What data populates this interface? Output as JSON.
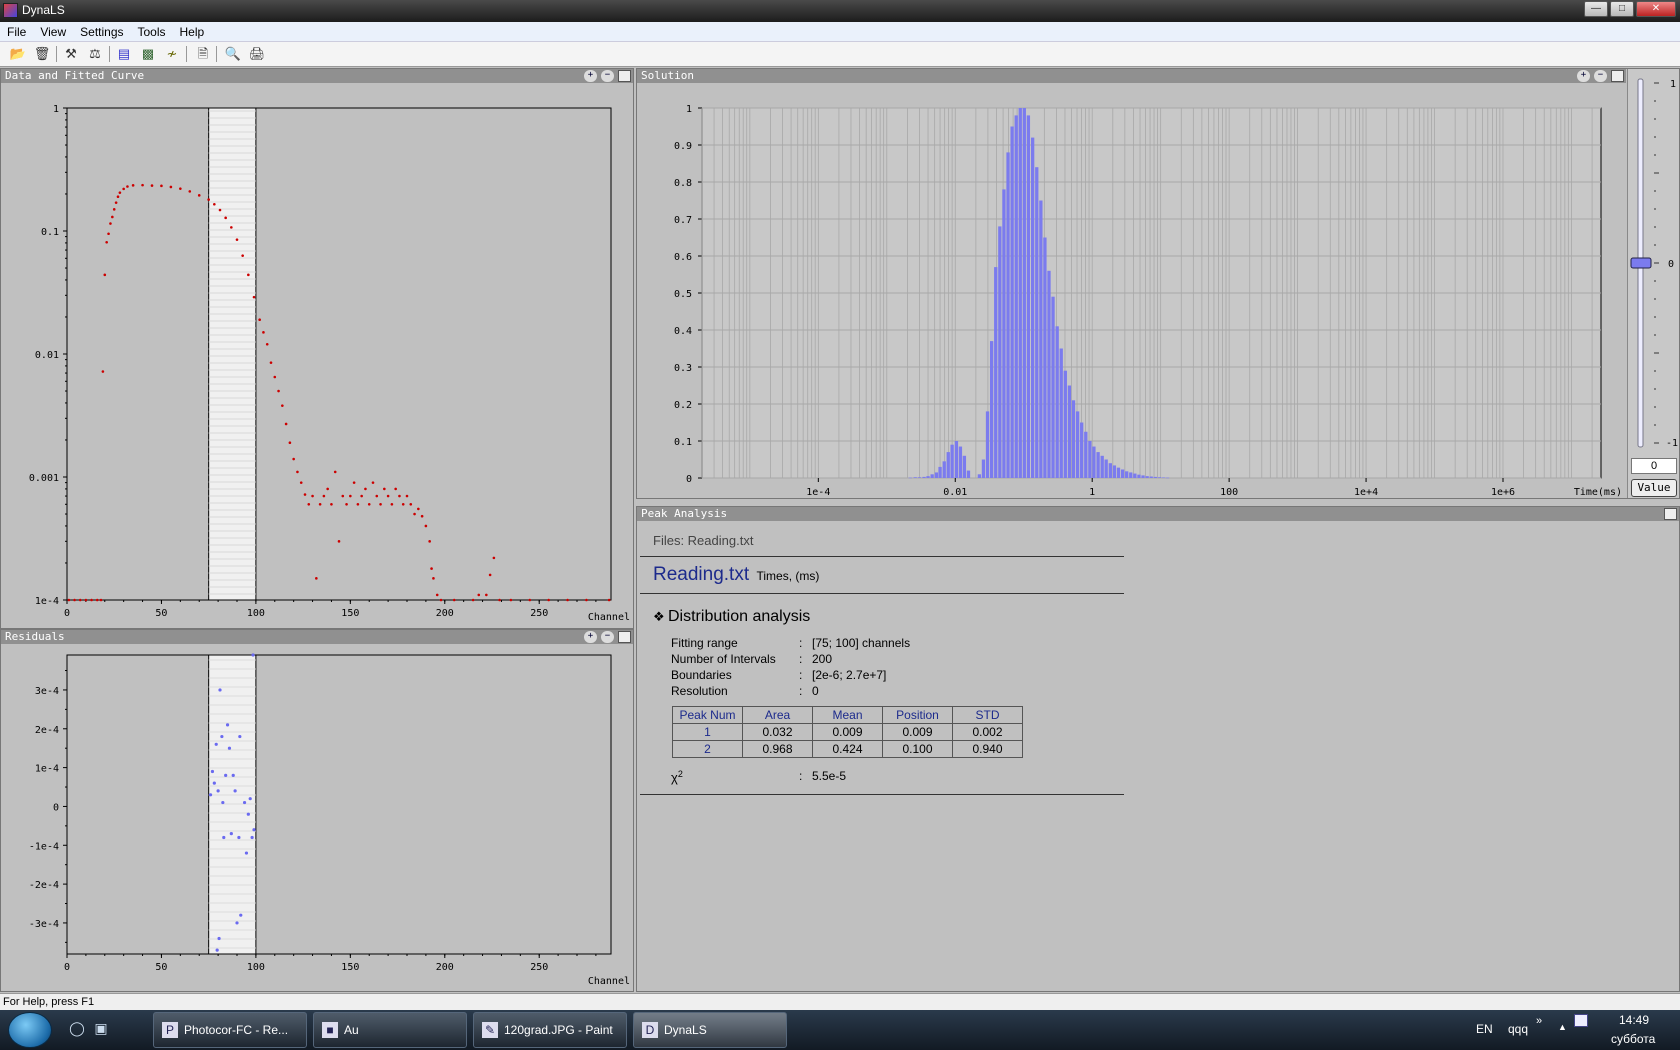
{
  "window": {
    "title": "DynaLS"
  },
  "menu": [
    "File",
    "View",
    "Settings",
    "Tools",
    "Help"
  ],
  "toolbar_icons": [
    "open-icon",
    "delete-icon",
    "tools-icon",
    "balance-icon",
    "histogram-icon",
    "bar-chart-icon",
    "fit-icon",
    "report-icon",
    "print-preview-icon",
    "print-icon"
  ],
  "panels": {
    "data": "Data and Fitted Curve",
    "residuals": "Residuals",
    "solution": "Solution",
    "peak": "Peak Analysis"
  },
  "chart_data": [
    {
      "type": "scatter",
      "title": "Data and Fitted Curve",
      "xlabel": "Channel",
      "xlim": [
        0,
        288
      ],
      "ylim": [
        0.0001,
        1
      ],
      "yscale": "log",
      "xticks": [
        0,
        50,
        100,
        150,
        200,
        250
      ],
      "yticks": [
        "1",
        "0.1",
        "0.01",
        "0.001",
        "1e-4"
      ],
      "fit_range": [
        75,
        100
      ],
      "series": [
        {
          "color": "#cc0000",
          "points": [
            [
              1,
              0.0001
            ],
            [
              4,
              0.0001
            ],
            [
              7,
              0.0001
            ],
            [
              10,
              0.0001
            ],
            [
              13,
              0.0001
            ],
            [
              16,
              0.0001
            ],
            [
              18,
              0.0001
            ],
            [
              19,
              0.0072
            ],
            [
              20,
              0.044
            ],
            [
              21,
              0.081
            ],
            [
              22,
              0.095
            ],
            [
              23,
              0.115
            ],
            [
              24,
              0.13
            ],
            [
              25,
              0.15
            ],
            [
              26,
              0.17
            ],
            [
              27,
              0.19
            ],
            [
              28,
              0.205
            ],
            [
              30,
              0.22
            ],
            [
              32,
              0.23
            ],
            [
              35,
              0.235
            ],
            [
              40,
              0.236
            ],
            [
              45,
              0.234
            ],
            [
              50,
              0.233
            ],
            [
              55,
              0.228
            ],
            [
              60,
              0.221
            ],
            [
              65,
              0.21
            ],
            [
              70,
              0.195
            ],
            [
              75,
              0.18
            ],
            [
              78,
              0.165
            ],
            [
              81,
              0.148
            ],
            [
              84,
              0.128
            ],
            [
              87,
              0.107
            ],
            [
              90,
              0.085
            ],
            [
              93,
              0.063
            ],
            [
              96,
              0.044
            ],
            [
              99,
              0.029
            ],
            [
              102,
              0.019
            ],
            [
              104,
              0.015
            ],
            [
              106,
              0.012
            ],
            [
              108,
              0.0085
            ],
            [
              110,
              0.0065
            ],
            [
              112,
              0.005
            ],
            [
              114,
              0.0038
            ],
            [
              116,
              0.0027
            ],
            [
              118,
              0.0019
            ],
            [
              120,
              0.0014
            ],
            [
              122,
              0.0011
            ],
            [
              124,
              0.0009
            ],
            [
              126,
              0.00072
            ],
            [
              128,
              0.0006
            ],
            [
              130,
              0.0007
            ],
            [
              132,
              0.00015
            ],
            [
              134,
              0.0006
            ],
            [
              136,
              0.0007
            ],
            [
              138,
              0.0008
            ],
            [
              140,
              0.0006
            ],
            [
              142,
              0.0011
            ],
            [
              144,
              0.0003
            ],
            [
              146,
              0.0007
            ],
            [
              148,
              0.0006
            ],
            [
              150,
              0.0007
            ],
            [
              152,
              0.0009
            ],
            [
              154,
              0.0006
            ],
            [
              156,
              0.0007
            ],
            [
              158,
              0.0008
            ],
            [
              160,
              0.0006
            ],
            [
              162,
              0.0009
            ],
            [
              164,
              0.0007
            ],
            [
              166,
              0.0006
            ],
            [
              168,
              0.0008
            ],
            [
              170,
              0.0007
            ],
            [
              172,
              0.0006
            ],
            [
              174,
              0.0008
            ],
            [
              176,
              0.0007
            ],
            [
              178,
              0.0006
            ],
            [
              180,
              0.0007
            ],
            [
              182,
              0.0006
            ],
            [
              184,
              0.0005
            ],
            [
              186,
              0.00055
            ],
            [
              188,
              0.00048
            ],
            [
              190,
              0.0004
            ],
            [
              192,
              0.0003
            ],
            [
              193,
              0.00018
            ],
            [
              194,
              0.00015
            ],
            [
              196,
              0.00011
            ],
            [
              198,
              0.0001
            ],
            [
              205,
              0.0001
            ],
            [
              215,
              0.0001
            ],
            [
              218,
              0.00011
            ],
            [
              222,
              0.00011
            ],
            [
              224,
              0.00016
            ],
            [
              226,
              0.00022
            ],
            [
              229,
              0.0001
            ],
            [
              235,
              0.0001
            ],
            [
              245,
              0.0001
            ],
            [
              255,
              0.0001
            ],
            [
              265,
              0.0001
            ],
            [
              275,
              0.0001
            ],
            [
              287,
              0.0001
            ]
          ]
        }
      ]
    },
    {
      "type": "scatter",
      "title": "Residuals",
      "xlabel": "Channel",
      "xlim": [
        0,
        288
      ],
      "ylim": [
        -0.00038,
        0.00039
      ],
      "xticks": [
        0,
        50,
        100,
        150,
        200,
        250
      ],
      "yticks": [
        "3e-4",
        "2e-4",
        "1e-4",
        "0",
        "-1e-4",
        "-2e-4",
        "-3e-4"
      ],
      "fit_range": [
        75,
        100
      ],
      "series": [
        {
          "color": "#6a6af0",
          "points": [
            [
              76,
              3e-05
            ],
            [
              77,
              9e-05
            ],
            [
              78,
              6e-05
            ],
            [
              79,
              0.00016
            ],
            [
              79.5,
              -0.00037
            ],
            [
              80,
              4e-05
            ],
            [
              80.5,
              -0.00034
            ],
            [
              81,
              0.0003
            ],
            [
              82,
              0.00018
            ],
            [
              82.5,
              1e-05
            ],
            [
              83,
              -8e-05
            ],
            [
              84,
              8e-05
            ],
            [
              85,
              0.00021
            ],
            [
              86,
              0.00015
            ],
            [
              87,
              -7e-05
            ],
            [
              88,
              8e-05
            ],
            [
              89,
              4e-05
            ],
            [
              90,
              -0.0003
            ],
            [
              91,
              -8e-05
            ],
            [
              91.5,
              0.00018
            ],
            [
              92,
              -0.00028
            ],
            [
              94,
              1e-05
            ],
            [
              95,
              -0.00012
            ],
            [
              96,
              -2e-05
            ],
            [
              97,
              2e-05
            ],
            [
              98,
              -8e-05
            ],
            [
              98.5,
              0.00039
            ],
            [
              99,
              -6e-05
            ]
          ]
        }
      ]
    },
    {
      "type": "bar",
      "title": "Solution",
      "xlabel": "Time(ms)",
      "xscale": "log",
      "xlim": [
        2e-06,
        27000000
      ],
      "ylim": [
        0,
        1
      ],
      "xticks": [
        "1e-4",
        "0.01",
        "1",
        "100",
        "1e+4",
        "1e+6"
      ],
      "yticks": [
        "0",
        "0.1",
        "0.2",
        "0.3",
        "0.4",
        "0.5",
        "0.6",
        "0.7",
        "0.8",
        "0.9",
        "1"
      ],
      "series": [
        {
          "color": "#7b7bee",
          "points": [
            [
              0.0022,
              0.001
            ],
            [
              0.0026,
              0.002
            ],
            [
              0.003,
              0.002
            ],
            [
              0.0035,
              0.003
            ],
            [
              0.004,
              0.005
            ],
            [
              0.0046,
              0.01
            ],
            [
              0.0053,
              0.015
            ],
            [
              0.006,
              0.03
            ],
            [
              0.0069,
              0.045
            ],
            [
              0.0079,
              0.07
            ],
            [
              0.009,
              0.09
            ],
            [
              0.0104,
              0.1
            ],
            [
              0.0119,
              0.085
            ],
            [
              0.0136,
              0.06
            ],
            [
              0.0156,
              0.02
            ],
            [
              0.0225,
              0.01
            ],
            [
              0.0258,
              0.05
            ],
            [
              0.0296,
              0.18
            ],
            [
              0.034,
              0.37
            ],
            [
              0.039,
              0.57
            ],
            [
              0.0448,
              0.68
            ],
            [
              0.0514,
              0.78
            ],
            [
              0.059,
              0.88
            ],
            [
              0.0677,
              0.95
            ],
            [
              0.0777,
              0.98
            ],
            [
              0.089,
              1.0
            ],
            [
              0.102,
              1.0
            ],
            [
              0.117,
              0.98
            ],
            [
              0.135,
              0.92
            ],
            [
              0.155,
              0.84
            ],
            [
              0.178,
              0.75
            ],
            [
              0.204,
              0.65
            ],
            [
              0.234,
              0.56
            ],
            [
              0.268,
              0.49
            ],
            [
              0.308,
              0.41
            ],
            [
              0.353,
              0.35
            ],
            [
              0.405,
              0.29
            ],
            [
              0.465,
              0.25
            ],
            [
              0.533,
              0.21
            ],
            [
              0.612,
              0.18
            ],
            [
              0.702,
              0.15
            ],
            [
              0.806,
              0.125
            ],
            [
              0.925,
              0.1
            ],
            [
              1.06,
              0.085
            ],
            [
              1.22,
              0.07
            ],
            [
              1.4,
              0.06
            ],
            [
              1.6,
              0.05
            ],
            [
              1.84,
              0.04
            ],
            [
              2.11,
              0.034
            ],
            [
              2.42,
              0.028
            ],
            [
              2.78,
              0.023
            ],
            [
              3.19,
              0.018
            ],
            [
              3.66,
              0.015
            ],
            [
              4.2,
              0.012
            ],
            [
              4.82,
              0.009
            ],
            [
              5.53,
              0.007
            ],
            [
              6.35,
              0.005
            ],
            [
              7.28,
              0.004
            ],
            [
              8.36,
              0.003
            ],
            [
              9.59,
              0.002
            ],
            [
              11,
              0.0015
            ],
            [
              12.6,
              0.001
            ]
          ]
        }
      ]
    }
  ],
  "slider": {
    "top": "1",
    "mid": "0",
    "bottom": "-1",
    "input_value": "0",
    "button": "Value",
    "level": 0
  },
  "peak": {
    "files": "Files: Reading.txt",
    "file_name": "Reading.txt",
    "file_sub": "Times, (ms)",
    "section_title": "Distribution analysis",
    "params": [
      {
        "label": "Fitting range",
        "value": "[75; 100] channels"
      },
      {
        "label": "Number of Intervals",
        "value": "200"
      },
      {
        "label": "Boundaries",
        "value": "[2e-6; 2.7e+7]"
      },
      {
        "label": "Resolution",
        "value": "0"
      }
    ],
    "table": {
      "headers": [
        "Peak Num",
        "Area",
        "Mean",
        "Position",
        "STD"
      ],
      "rows": [
        [
          "1",
          "0.032",
          "0.009",
          "0.009",
          "0.002"
        ],
        [
          "2",
          "0.968",
          "0.424",
          "0.100",
          "0.940"
        ]
      ]
    },
    "chi_label": "χ",
    "chi_sup": "2",
    "chi_value": "5.5e-5"
  },
  "status": "For Help, press F1",
  "taskbar": {
    "items": [
      "Photocor-FC - Re...",
      "Au",
      "120grad.JPG - Paint",
      "DynaLS"
    ],
    "lang": "EN",
    "user": "qqq",
    "more": "»",
    "time": "14:49",
    "day": "суббота"
  }
}
